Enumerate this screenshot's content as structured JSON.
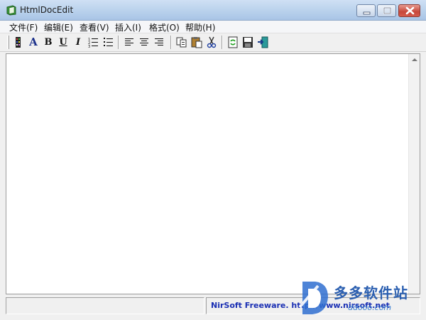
{
  "window": {
    "title": "HtmlDocEdit",
    "icon": "book-icon"
  },
  "menu": {
    "items": [
      "文件(F)",
      "编辑(E)",
      "查看(V)",
      "插入(I)",
      "格式(O)",
      "帮助(H)"
    ]
  },
  "toolbar": {
    "buttons": [
      "font-color-icon",
      "font-icon",
      "bold-icon",
      "underline-icon",
      "italic-icon",
      "numbered-list-icon",
      "bullet-list-icon",
      "align-left-icon",
      "align-center-icon",
      "align-right-icon",
      "copy-icon",
      "paste-icon",
      "cut-icon",
      "refresh-icon",
      "save-icon",
      "exit-icon"
    ],
    "glyphs": {
      "font": "A",
      "bold": "B",
      "underline": "U",
      "italic": "I"
    }
  },
  "status": {
    "left": "",
    "right": "NirSoft Freeware.  http://www.nirsoft.net"
  },
  "watermark": {
    "title": "多多软件站",
    "url": "ddooo.com"
  },
  "colors": {
    "status_text": "#1a2fb3",
    "watermark": "#2b5fb0"
  }
}
